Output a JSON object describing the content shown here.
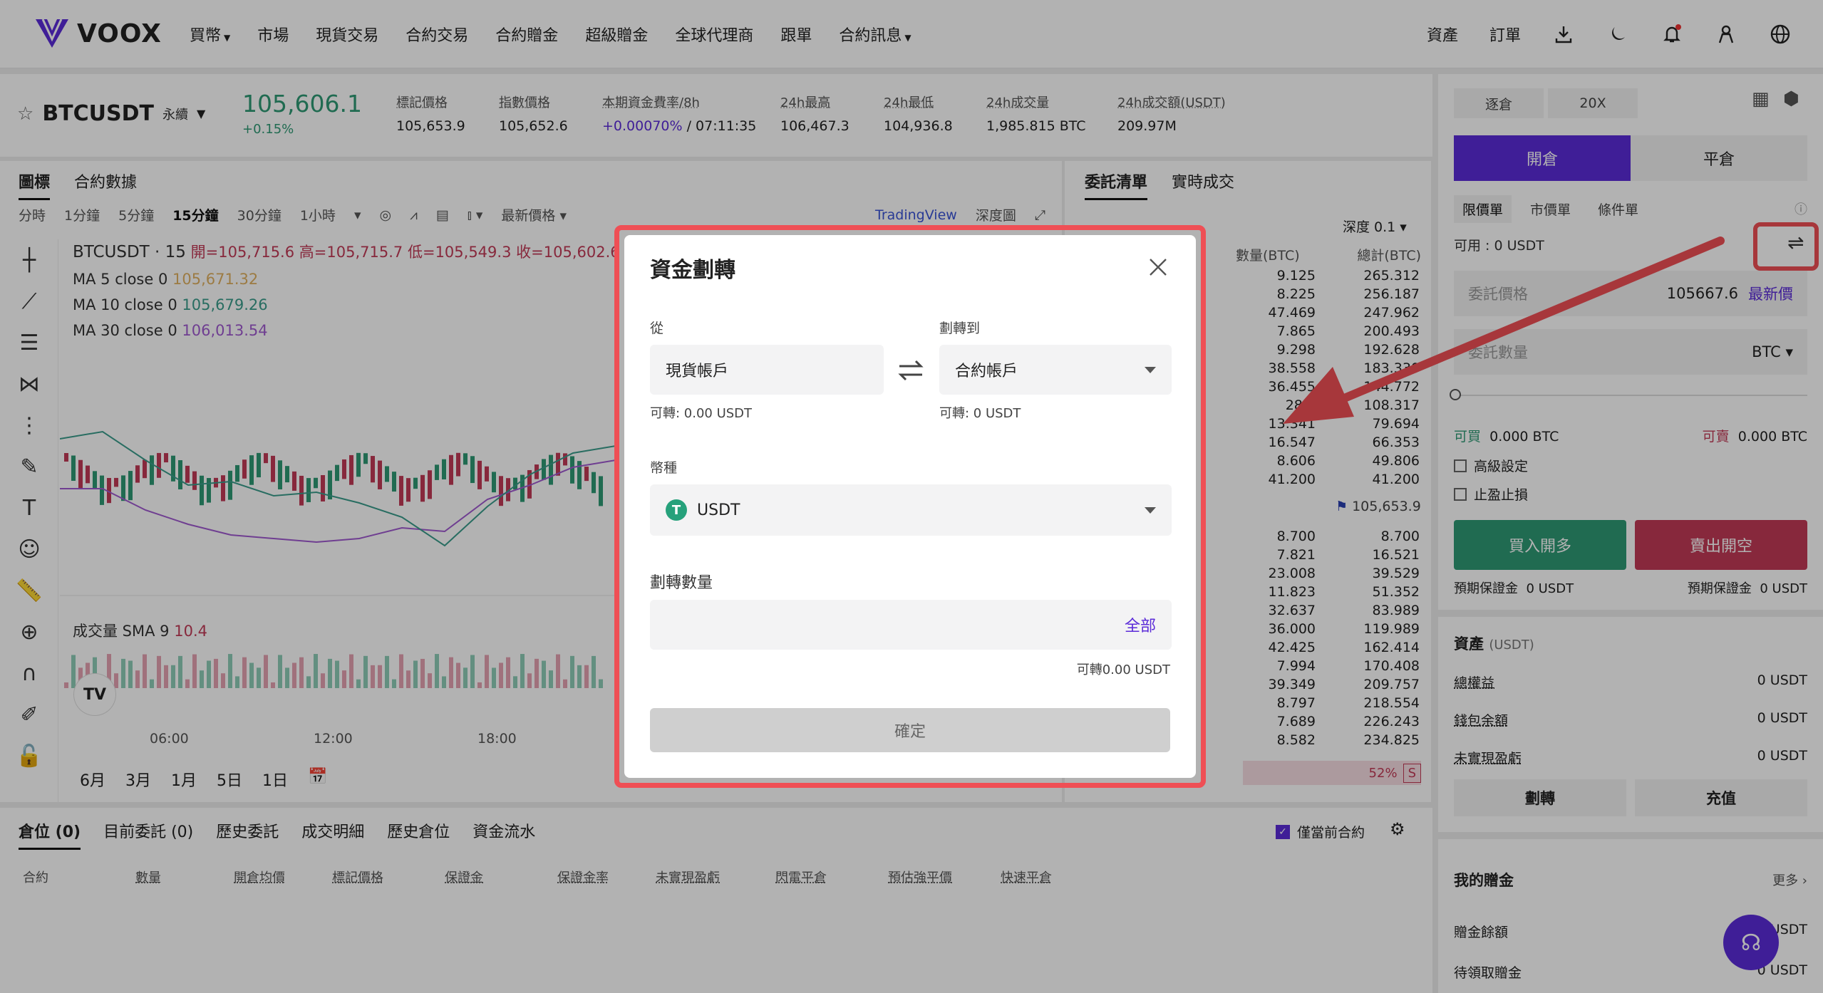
{
  "brand": {
    "name": "VOOX",
    "color": "#5b2bd8"
  },
  "nav": {
    "items": [
      {
        "label": "買幣",
        "caret": true
      },
      {
        "label": "市場"
      },
      {
        "label": "現貨交易"
      },
      {
        "label": "合約交易"
      },
      {
        "label": "合約贈金"
      },
      {
        "label": "超級贈金"
      },
      {
        "label": "全球代理商"
      },
      {
        "label": "跟單"
      },
      {
        "label": "合約訊息",
        "caret": true
      }
    ]
  },
  "topright": {
    "assets": "資產",
    "orders": "訂單",
    "icons": [
      "download-icon",
      "moon-icon",
      "bell-icon",
      "user-icon",
      "globe-icon"
    ]
  },
  "ticker": {
    "symbol": "BTCUSDT",
    "type": "永續",
    "last_price": "105,606.1",
    "change": "+0.15%",
    "stats": [
      {
        "label": "標記價格",
        "value": "105,653.9"
      },
      {
        "label": "指數價格",
        "value": "105,652.6"
      },
      {
        "label": "本期資金費率/8h",
        "value_a": "+0.00070%",
        "value_b": " / 07:11:35"
      },
      {
        "label": "24h最高",
        "value": "106,467.3"
      },
      {
        "label": "24h最低",
        "value": "104,936.8"
      },
      {
        "label": "24h成交量",
        "value": "1,985.815 BTC"
      },
      {
        "label": "24h成交額(USDT)",
        "value": "209.97M"
      }
    ]
  },
  "chart": {
    "tabs": [
      "圖標",
      "合約數據"
    ],
    "intervals": [
      "分時",
      "1分鐘",
      "5分鐘",
      "15分鐘",
      "30分鐘",
      "1小時"
    ],
    "active_interval": "15分鐘",
    "latest_price_label": "最新價格",
    "tradingview": "TradingView",
    "depth": "深度圖",
    "legend": {
      "title": "BTCUSDT · 15",
      "open": "開=105,715.6",
      "high": "高=105,715.7",
      "low": "低=105,549.3",
      "close": "收=105,602.6",
      "ma5": "MA 5 close 0",
      "ma5_val": "105,671.32",
      "ma10": "MA 10 close 0",
      "ma10_val": "105,679.26",
      "ma30": "MA 30 close 0",
      "ma30_val": "106,013.54"
    },
    "volume_label": "成交量 SMA 9",
    "volume_val": "10.4",
    "time_ticks": [
      "06:00",
      "12:00",
      "18:00"
    ],
    "ranges": [
      "6月",
      "3月",
      "1月",
      "5日",
      "1日"
    ]
  },
  "orderbook": {
    "tabs": [
      "委託清單",
      "實時成交"
    ],
    "depth": "深度 0.1",
    "col_qty": "數量(BTC)",
    "col_total": "總計(BTC)",
    "asks": [
      [
        "9.125",
        "265.312"
      ],
      [
        "8.225",
        "256.187"
      ],
      [
        "47.469",
        "247.962"
      ],
      [
        "7.865",
        "200.493"
      ],
      [
        "9.298",
        "192.628"
      ],
      [
        "38.558",
        "183.330"
      ],
      [
        "36.455",
        "144.772"
      ],
      [
        "28.4",
        "108.317"
      ],
      [
        "13.341",
        "79.694"
      ],
      [
        "16.547",
        "66.353"
      ],
      [
        "8.606",
        "49.806"
      ],
      [
        "41.200",
        "41.200"
      ]
    ],
    "mark": "105,653.9",
    "bids": [
      [
        "8.700",
        "8.700"
      ],
      [
        "7.821",
        "16.521"
      ],
      [
        "23.008",
        "39.529"
      ],
      [
        "11.823",
        "51.352"
      ],
      [
        "32.637",
        "83.989"
      ],
      [
        "36.000",
        "119.989"
      ],
      [
        "42.425",
        "162.414"
      ],
      [
        "7.994",
        "170.408"
      ],
      [
        "39.349",
        "209.757"
      ],
      [
        "8.797",
        "218.554"
      ],
      [
        "7.689",
        "226.243"
      ],
      [
        "8.582",
        "234.825"
      ]
    ],
    "ratio": "52%",
    "ratio_side": "S"
  },
  "trade": {
    "margin_mode": "逐倉",
    "leverage": "20X",
    "open": "開倉",
    "close": "平倉",
    "order_types": [
      "限價單",
      "市價單",
      "條件單"
    ],
    "available": "可用 : 0 USDT",
    "price_placeholder": "委託價格",
    "price_value": "105667.6",
    "latest": "最新價",
    "qty_placeholder": "委託數量",
    "qty_unit": "BTC",
    "can_buy": "可買",
    "can_buy_val": "0.000 BTC",
    "can_sell": "可賣",
    "can_sell_val": "0.000 BTC",
    "adv": "高級設定",
    "tpsl": "止盈止損",
    "buy_btn": "買入開多",
    "sell_btn": "賣出開空",
    "est_margin": "預期保證金",
    "est_margin_val": "0 USDT"
  },
  "assets": {
    "title": "資產",
    "unit": "(USDT)",
    "rows": [
      {
        "k": "總權益",
        "v": "0 USDT"
      },
      {
        "k": "錢包余額",
        "v": "0 USDT"
      },
      {
        "k": "未實現盈虧",
        "v": "0 USDT"
      }
    ],
    "transfer": "劃轉",
    "deposit": "充值"
  },
  "bonus": {
    "title": "我的贈金",
    "more": "更多",
    "rows": [
      {
        "k": "贈金餘額",
        "v": "0 USDT"
      },
      {
        "k": "待領取贈金",
        "v": "0 USDT"
      }
    ]
  },
  "positions": {
    "tabs": [
      "倉位 (0)",
      "目前委託 (0)",
      "歷史委託",
      "成交明細",
      "歷史倉位",
      "資金流水"
    ],
    "only_current": "僅當前合約",
    "cols": [
      "合約",
      "數量",
      "開倉均價",
      "標記價格",
      "保證金",
      "保證金率",
      "未實現盈虧",
      "閃電平倉",
      "預估強平價",
      "快速平倉"
    ]
  },
  "modal": {
    "title": "資金劃轉",
    "from_label": "從",
    "to_label": "劃轉到",
    "from_value": "現貨帳戶",
    "to_value": "合約帳戶",
    "from_avail": "可轉: 0.00 USDT",
    "to_avail": "可轉: 0 USDT",
    "coin_label": "幣種",
    "coin_value": "USDT",
    "amount_label": "劃轉數量",
    "all": "全部",
    "amount_avail": "可轉0.00 USDT",
    "confirm": "確定"
  }
}
